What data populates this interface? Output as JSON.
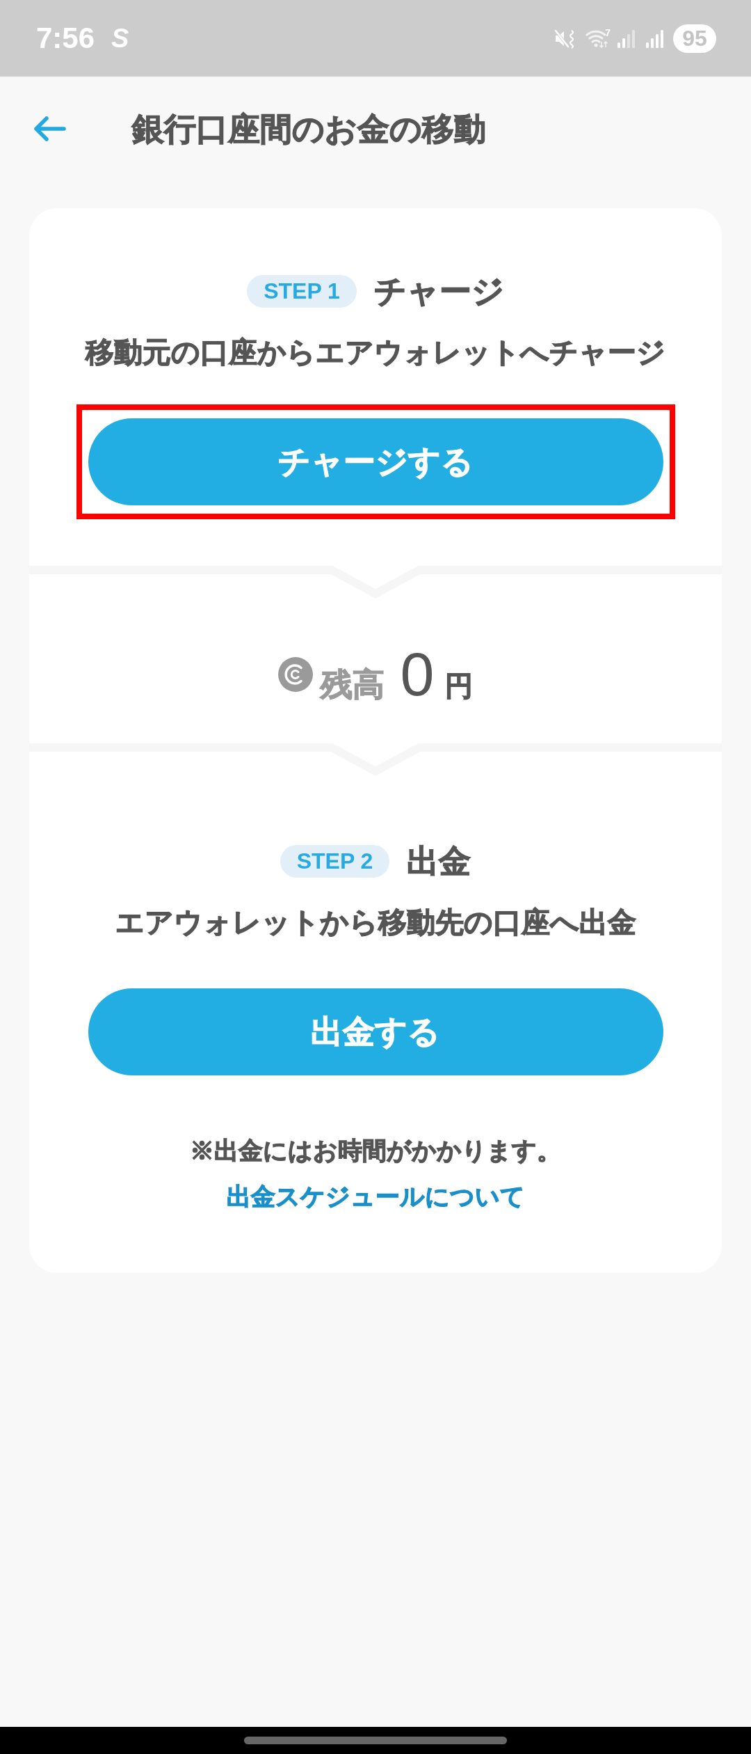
{
  "status_bar": {
    "time": "7:56",
    "notification": "S",
    "wifi_label": "7",
    "battery": "95"
  },
  "header": {
    "title": "銀行口座間のお金の移動"
  },
  "sections": [
    {
      "kind": "step",
      "badge": "STEP 1",
      "title": "チャージ",
      "description": "移動元の口座からエアウォレットへチャージ",
      "button": "チャージする",
      "highlighted": true
    },
    {
      "kind": "balance",
      "label": "残高",
      "amount": "0",
      "unit": "円"
    },
    {
      "kind": "step",
      "badge": "STEP 2",
      "title": "出金",
      "description": "エアウォレットから移動先の口座へ出金",
      "button": "出金する",
      "highlighted": false,
      "note": "※出金にはお時間がかかります。",
      "link": "出金スケジュールについて"
    }
  ]
}
